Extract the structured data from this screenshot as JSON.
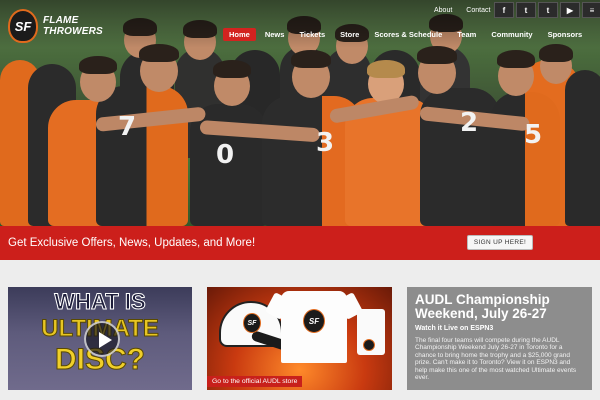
{
  "brand": {
    "logo_mark": "SF",
    "name_line1": "FLAME",
    "name_line2": "THROWERS"
  },
  "utility_nav": [
    "About",
    "Contact"
  ],
  "social": [
    {
      "icon": "facebook-icon",
      "glyph": "f"
    },
    {
      "icon": "twitter-icon",
      "glyph": "t"
    },
    {
      "icon": "tumblr-icon",
      "glyph": "t"
    },
    {
      "icon": "youtube-icon",
      "glyph": "▶"
    },
    {
      "icon": "rss-icon",
      "glyph": "≡"
    }
  ],
  "nav": {
    "items": [
      "Home",
      "News",
      "Tickets",
      "Store",
      "Scores & Schedule",
      "Team",
      "Community",
      "Sponsors"
    ],
    "active": "Home",
    "search_icon": "search-icon"
  },
  "hero": {
    "jersey_numbers": [
      "7",
      "0",
      "3",
      "2",
      "5"
    ]
  },
  "offers": {
    "text": "Get Exclusive Offers, News, Updates, and More!",
    "button": "SIGN UP HERE!"
  },
  "video_card": {
    "line1": "WHAT IS",
    "line2": "ULTIMATE",
    "line3": "DISC?"
  },
  "store_card": {
    "caption": "Go to the official AUDL store",
    "product_mark": "SF"
  },
  "news_card": {
    "title": "AUDL Championship Weekend, July 26-27",
    "subtitle": "Watch it Live on ESPN3",
    "body": "The final four teams will compete during the AUDL Championship Weekend July 26-27 in Toronto for a chance to bring home the trophy and a $25,000 grand prize. Can't make it to Toronto? View it on ESPN3 and help make this one of the most watched Ultimate events ever."
  },
  "colors": {
    "accent_red": "#cc1f1b",
    "brand_orange": "#e06a1d"
  }
}
